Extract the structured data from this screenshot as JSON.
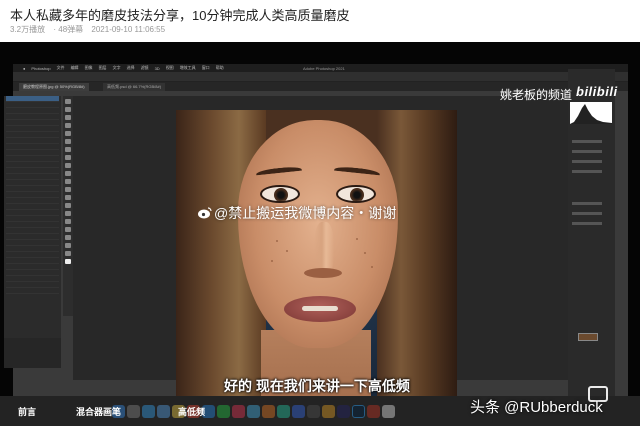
{
  "article": {
    "title": "本人私藏多年的磨皮技法分享，10分钟完成人类高质量磨皮",
    "views": "3.2万播放",
    "danmaku": "· 48弹幕",
    "date": "2021-09-10 11:06:55"
  },
  "app": {
    "name": "Photoshop",
    "window_title": "Adobe Photoshop 2021",
    "menus": [
      "文件",
      "编辑",
      "图像",
      "图层",
      "文字",
      "选择",
      "滤镜",
      "3D",
      "视图",
      "增效工具",
      "窗口",
      "帮助"
    ],
    "doc_tab": "磨皮教程原图.jpg @ 50%(RGB/8#)",
    "doc_tab2": "高低频.psd @ 66.7%(RGB/8#)"
  },
  "overlay": {
    "watermark": "@禁止搬运我微博内容・谢谢",
    "caption": "好的 现在我们来讲一下高低频",
    "channel": "姚老板的频道",
    "brand": "bilibili",
    "source": "头条 @RUbberduck"
  },
  "subtitles_bar": {
    "left": "前言",
    "mid": "混合器画笔",
    "right": "高低频"
  },
  "colors": {
    "accent": "#3b5f85",
    "panel": "#2b2b2b"
  }
}
